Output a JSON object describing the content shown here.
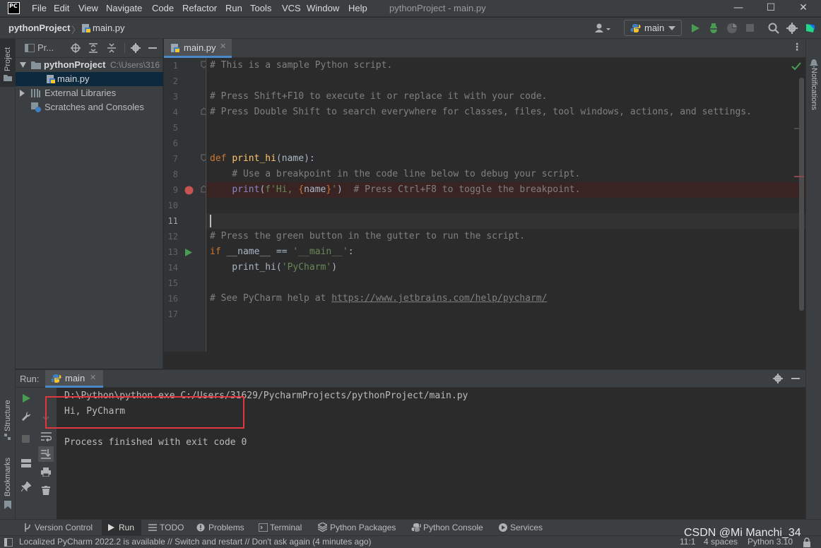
{
  "app": {
    "logo_text": "PC",
    "window_title": "pythonProject - main.py"
  },
  "menu": [
    "File",
    "Edit",
    "View",
    "Navigate",
    "Code",
    "Refactor",
    "Run",
    "Tools",
    "VCS",
    "Window",
    "Help"
  ],
  "window_controls": {
    "minimize": "—",
    "maximize": "☐",
    "close": "✕"
  },
  "navbar": {
    "project": "pythonProject",
    "file": "main.py",
    "run_config": "main"
  },
  "left_strip": {
    "project_label": "Project",
    "structure_label": "Structure",
    "bookmarks_label": "Bookmarks"
  },
  "right_strip": {
    "notifications_label": "Notifications"
  },
  "project_panel": {
    "header_label": "Pr...",
    "tree": [
      {
        "label": "pythonProject",
        "path": "C:\\Users\\316"
      },
      {
        "label": "main.py"
      },
      {
        "label": "External Libraries"
      },
      {
        "label": "Scratches and Consoles"
      }
    ]
  },
  "editor": {
    "tab": "main.py",
    "line_numbers": [
      "1",
      "2",
      "3",
      "4",
      "5",
      "6",
      "7",
      "8",
      "9",
      "10",
      "11",
      "12",
      "13",
      "14",
      "15",
      "16",
      "17"
    ],
    "lines": {
      "l1": "# This is a sample Python script.",
      "l3": "# Press Shift+F10 to execute it or replace it with your code.",
      "l4": "# Press Double Shift to search everywhere for classes, files, tool windows, actions, and settings.",
      "l7_def": "def",
      "l7_fn": "print_hi",
      "l7_rest": "(name):",
      "l8": "    # Use a breakpoint in the code line below to debug your script.",
      "l9_indent": "    ",
      "l9_print": "print",
      "l9_paren": "(",
      "l9_str1": "f'Hi, ",
      "l9_brace1": "{",
      "l9_name": "name",
      "l9_brace2": "}",
      "l9_str2": "'",
      "l9_close": ")  ",
      "l9_comment": "# Press Ctrl+F8 to toggle the breakpoint.",
      "l12": "# Press the green button in the gutter to run the script.",
      "l13_if": "if",
      "l13_mid": " __name__ == ",
      "l13_str": "'__main__'",
      "l13_end": ":",
      "l14_indent": "    print_hi(",
      "l14_str": "'PyCharm'",
      "l14_end": ")",
      "l16_pre": "# See PyCharm help at ",
      "l16_link": "https://www.jetbrains.com/help/pycharm/"
    }
  },
  "run_panel": {
    "label": "Run:",
    "tab": "main",
    "output": [
      "D:\\Python\\python.exe C:/Users/31629/PycharmProjects/pythonProject/main.py",
      "Hi, PyCharm",
      "",
      "Process finished with exit code 0"
    ]
  },
  "tool_windows": [
    "Version Control",
    "Run",
    "TODO",
    "Problems",
    "Terminal",
    "Python Packages",
    "Python Console",
    "Services"
  ],
  "status_bar": {
    "message": "Localized PyCharm 2022.2 is available // Switch and restart // Don't ask again (4 minutes ago)",
    "position": "11:1",
    "indent": "4 spaces",
    "interpreter": "Python 3.10"
  },
  "watermark": "CSDN @Mi Manchi_34",
  "colors": {
    "highlight_box": "#e0383e",
    "accent": "#4a88c7",
    "run_green": "#499c54",
    "breakpoint": "#c75450"
  }
}
